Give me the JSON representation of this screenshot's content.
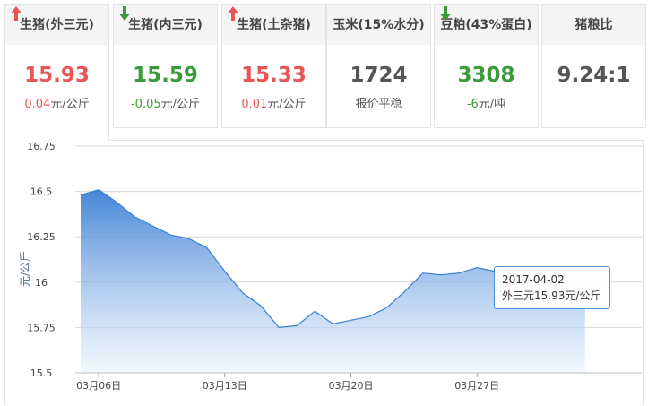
{
  "cards": [
    {
      "title": "生猪(外三元)",
      "price": "15.93",
      "trend": "up",
      "change_value": "0.04",
      "change_unit": "元/公斤",
      "active": true
    },
    {
      "title": "生猪(内三元)",
      "price": "15.59",
      "trend": "down",
      "change_value": "-0.05",
      "change_unit": "元/公斤",
      "active": false
    },
    {
      "title": "生猪(土杂猪)",
      "price": "15.33",
      "trend": "up",
      "change_value": "0.01",
      "change_unit": "元/公斤",
      "active": false
    },
    {
      "title": "玉米(15%水分)",
      "price": "1724",
      "trend": "neutral",
      "change_value": "",
      "change_unit": "报价平稳",
      "active": false
    },
    {
      "title": "豆粕(43%蛋白)",
      "price": "3308",
      "trend": "down",
      "change_value": "-6",
      "change_unit": "元/吨",
      "active": false
    },
    {
      "title": "猪粮比",
      "price": "9.24:1",
      "trend": "neutral",
      "change_value": "",
      "change_unit": "",
      "active": false
    }
  ],
  "colors": {
    "up": "#e95454",
    "down": "#3a9b3a",
    "line": "#3a7fd5",
    "fill_top": "#3a7fd5",
    "fill_bottom": "#e9f2fc",
    "grid": "#d8d8d8"
  },
  "chart_data": {
    "type": "area",
    "ylabel": "元/公斤",
    "ylim": [
      15.5,
      16.75
    ],
    "yticks": [
      "16.75",
      "16.5",
      "16.25",
      "16",
      "15.75",
      "15.5"
    ],
    "xticks": [
      "03月06日",
      "03月13日",
      "03月20日",
      "03月27日"
    ],
    "x": [
      "2017-03-05",
      "2017-03-06",
      "2017-03-07",
      "2017-03-08",
      "2017-03-09",
      "2017-03-10",
      "2017-03-11",
      "2017-03-12",
      "2017-03-13",
      "2017-03-14",
      "2017-03-15",
      "2017-03-16",
      "2017-03-17",
      "2017-03-18",
      "2017-03-19",
      "2017-03-20",
      "2017-03-21",
      "2017-03-22",
      "2017-03-23",
      "2017-03-24",
      "2017-03-25",
      "2017-03-26",
      "2017-03-27",
      "2017-03-28",
      "2017-03-29",
      "2017-03-30",
      "2017-03-31",
      "2017-04-01",
      "2017-04-02"
    ],
    "series": [
      {
        "values": [
          16.48,
          16.51,
          16.44,
          16.36,
          16.31,
          16.26,
          16.24,
          16.19,
          16.06,
          15.94,
          15.87,
          15.75,
          15.76,
          15.84,
          15.77,
          15.79,
          15.81,
          15.86,
          15.95,
          16.05,
          16.04,
          16.05,
          16.08,
          16.06,
          16.05,
          16.03,
          16.0,
          15.96,
          15.93
        ]
      }
    ],
    "grid": true,
    "legend": "none",
    "tooltip": {
      "date": "2017-04-02",
      "label": "外三元15.93元/公斤"
    }
  }
}
